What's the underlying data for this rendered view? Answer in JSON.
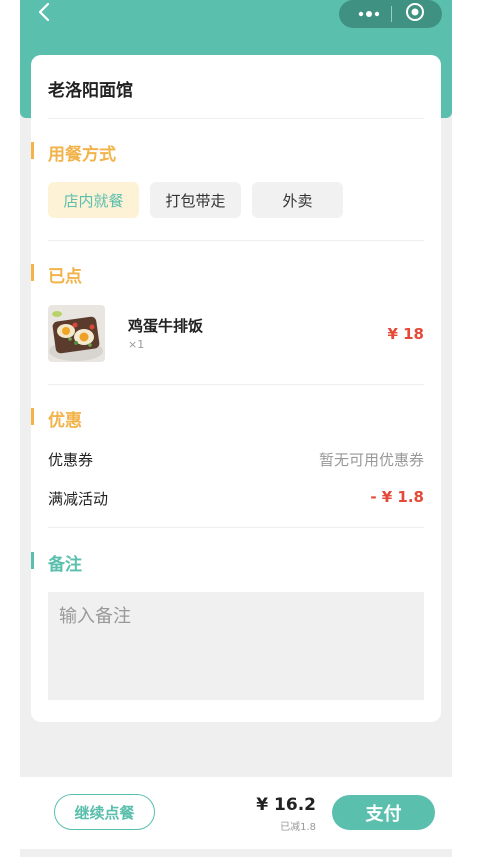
{
  "nav": {
    "back_icon": "chevron-left-icon",
    "more_icon": "more-dots-icon",
    "target_icon": "target-icon",
    "more_text": "•••"
  },
  "shop": {
    "name": "老洛阳面馆"
  },
  "dining": {
    "title": "用餐方式",
    "options": [
      {
        "label": "店内就餐",
        "selected": true
      },
      {
        "label": "打包带走",
        "selected": false
      },
      {
        "label": "外卖",
        "selected": false
      }
    ]
  },
  "ordered": {
    "title": "已点",
    "items": [
      {
        "name": "鸡蛋牛排饭",
        "qty": "×1",
        "price": "¥ 18"
      }
    ]
  },
  "discount": {
    "title": "优惠",
    "coupon_label": "优惠券",
    "coupon_value": "暂无可用优惠券",
    "promo_label": "满减活动",
    "promo_value": "- ¥ 1.8"
  },
  "remark": {
    "title": "备注",
    "placeholder": "输入备注"
  },
  "footer": {
    "continue_label": "继续点餐",
    "total": "¥ 16.2",
    "reduced": "已减1.8",
    "pay_label": "支付"
  },
  "colors": {
    "brand": "#5bbfae",
    "section_title": "#f2b34a",
    "price": "#e34a3a",
    "selected_bg": "#fdf1d6"
  }
}
